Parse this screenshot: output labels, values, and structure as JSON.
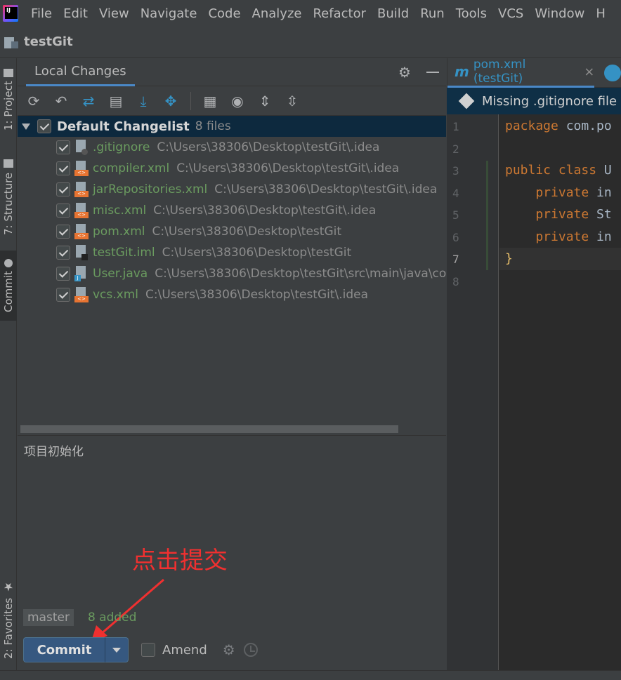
{
  "menu": {
    "items": [
      "File",
      "Edit",
      "View",
      "Navigate",
      "Code",
      "Analyze",
      "Refactor",
      "Build",
      "Run",
      "Tools",
      "VCS",
      "Window",
      "H"
    ]
  },
  "project": {
    "name": "testGit"
  },
  "left_strip": {
    "tabs": [
      "1: Project",
      "7: Structure",
      "Commit",
      "2: Favorites"
    ]
  },
  "commit_panel": {
    "tab_label": "Local Changes",
    "changelist": {
      "name": "Default Changelist",
      "count": "8 files"
    },
    "files": [
      {
        "name": ".gitignore",
        "path": "C:\\Users\\38306\\Desktop\\testGit\\.idea",
        "icon": "ignore-file-icon"
      },
      {
        "name": "compiler.xml",
        "path": "C:\\Users\\38306\\Desktop\\testGit\\.idea",
        "icon": "xml-file-icon"
      },
      {
        "name": "jarRepositories.xml",
        "path": "C:\\Users\\38306\\Desktop\\testGit\\.idea",
        "icon": "xml-file-icon"
      },
      {
        "name": "misc.xml",
        "path": "C:\\Users\\38306\\Desktop\\testGit\\.idea",
        "icon": "xml-file-icon"
      },
      {
        "name": "pom.xml",
        "path": "C:\\Users\\38306\\Desktop\\testGit",
        "icon": "xml-file-icon"
      },
      {
        "name": "testGit.iml",
        "path": "C:\\Users\\38306\\Desktop\\testGit",
        "icon": "iml-file-icon"
      },
      {
        "name": "User.java",
        "path": "C:\\Users\\38306\\Desktop\\testGit\\src\\main\\java\\co",
        "icon": "java-file-icon"
      },
      {
        "name": "vcs.xml",
        "path": "C:\\Users\\38306\\Desktop\\testGit\\.idea",
        "icon": "xml-file-icon"
      }
    ],
    "commit_message": "项目初始化",
    "annotation": "点击提交",
    "branch": "master",
    "added": "8 added",
    "commit_label": "Commit",
    "amend_label": "Amend"
  },
  "editor": {
    "tab_label": "pom.xml (testGit)",
    "tab_icon_letter": "m",
    "notification": "Missing .gitignore file in",
    "line_numbers": [
      "1",
      "2",
      "3",
      "4",
      "5",
      "6",
      "7",
      "8"
    ],
    "lines": [
      {
        "kw": "package",
        "rest": " com.po"
      },
      {
        "kw": "",
        "rest": ""
      },
      {
        "kw": "public class",
        "rest": " U"
      },
      {
        "kw": "    private",
        "rest": " in"
      },
      {
        "kw": "    private",
        "rest": " St"
      },
      {
        "kw": "    private",
        "rest": " in"
      },
      {
        "kw": "",
        "rest": "}"
      },
      {
        "kw": "",
        "rest": ""
      }
    ]
  },
  "colors": {
    "accent": "#4a88c7",
    "added_file": "#6a9b5f",
    "annotation": "#f03030",
    "commit_button": "#365880"
  }
}
